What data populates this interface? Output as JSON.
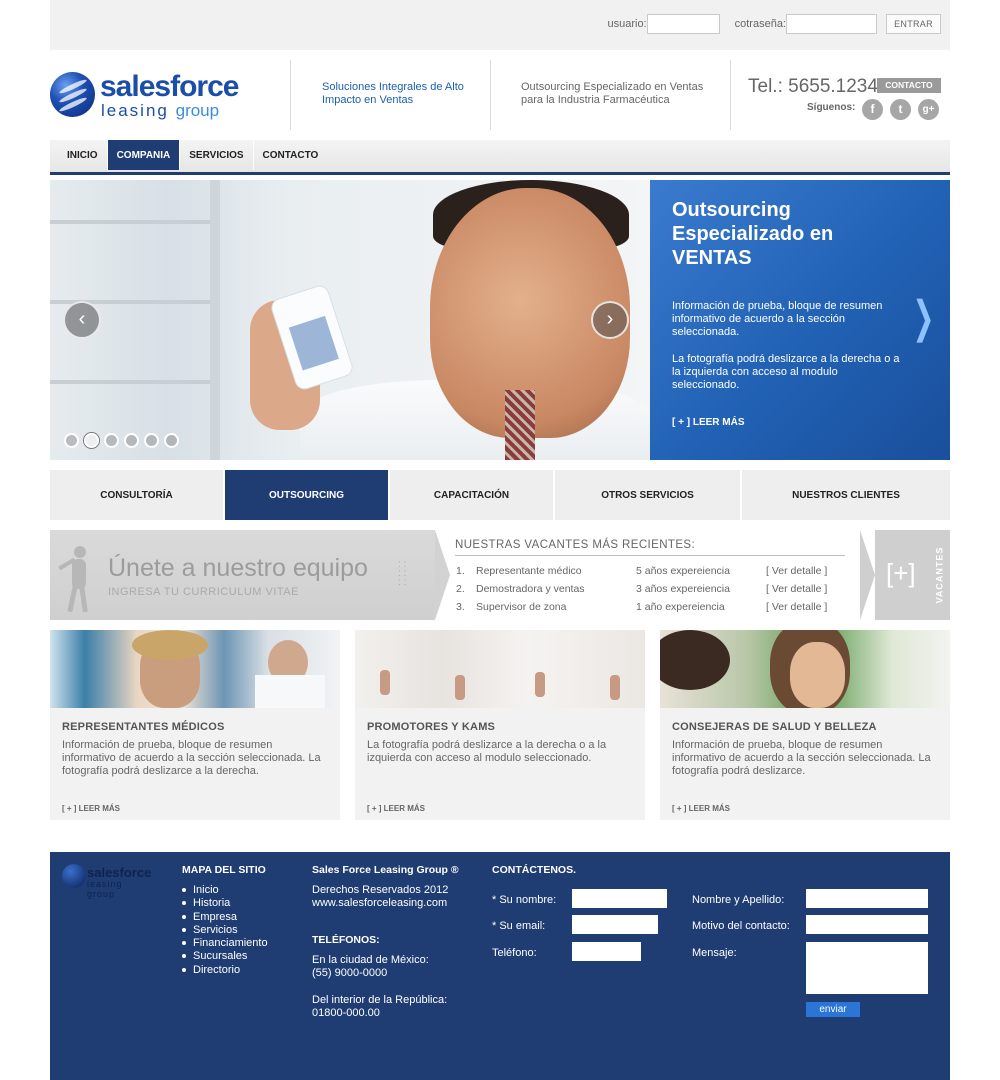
{
  "login": {
    "user_label": "usuario:",
    "pass_label": "cotraseña:",
    "submit_label": "ENTRAR"
  },
  "header": {
    "logo_word1": "salesforce",
    "logo_word2a": "leasing",
    "logo_word2b": "group",
    "tagline1": "Soluciones Integrales de Alto Impacto en Ventas",
    "tagline2": "Outsourcing Especializado en Ventas para la Industria Farmacéutica",
    "phone": "Tel.: 5655.1234",
    "contact_label": "CONTACTO",
    "follow_label": "Síguenos:",
    "social": [
      {
        "icon": "facebook-icon",
        "glyph": "f"
      },
      {
        "icon": "twitter-icon",
        "glyph": "t"
      },
      {
        "icon": "google-plus-icon",
        "glyph": "g+"
      }
    ]
  },
  "nav": {
    "items": [
      {
        "label": "INICIO",
        "active": false
      },
      {
        "label": "COMPANIA",
        "active": true
      },
      {
        "label": "SERVICIOS",
        "active": false
      },
      {
        "label": "CONTACTO",
        "active": false
      }
    ]
  },
  "hero": {
    "title": "Outsourcing Especializado en VENTAS",
    "para1": "Información de prueba, bloque de resumen informativo de acuerdo a la sección seleccionada.",
    "para2": "La fotografía podrá deslizarce a la derecha o a la izquierda con acceso al modulo seleccionado.",
    "more": "[ + ] LEER MÁS",
    "slide_count": 6,
    "active_slide": 2
  },
  "tabs": [
    {
      "label": "CONSULTORÍA",
      "active": false
    },
    {
      "label": "OUTSOURCING",
      "active": true
    },
    {
      "label": "CAPACITACIÓN",
      "active": false
    },
    {
      "label": "OTROS SERVICIOS",
      "active": false
    },
    {
      "label": "NUESTROS CLIENTES",
      "active": false
    }
  ],
  "vacancies": {
    "join_title": "Únete a nuestro equipo",
    "join_sub": "INGRESA TU CURRICULUM VITAE",
    "list_title": "NUESTRAS VACANTES MÁS RECIENTES:",
    "rows": [
      {
        "num": "1.",
        "position": "Representante médico",
        "experience": "5 años expereiencia",
        "link": "[ Ver detalle ]"
      },
      {
        "num": "2.",
        "position": "Demostradora y ventas",
        "experience": "3 años expereiencia",
        "link": "[ Ver detalle ]"
      },
      {
        "num": "3.",
        "position": "Supervisor de zona",
        "experience": "1 año expereiencia",
        "link": "[ Ver detalle ]"
      }
    ],
    "more_symbol": "[+]",
    "more_label": "VACANTES"
  },
  "cards": [
    {
      "title": "REPRESENTANTES MÉDICOS",
      "text": "Información de prueba, bloque de resumen informativo de acuerdo a la sección seleccionada. La fotografía podrá deslizarce a la derecha.",
      "more": "[ + ] LEER MÁS"
    },
    {
      "title": "PROMOTORES Y KAMS",
      "text": "La fotografía podrá deslizarce a la derecha o a la izquierda con acceso al modulo seleccionado.",
      "more": "[ + ] LEER MÁS"
    },
    {
      "title": "CONSEJERAS DE SALUD Y BELLEZA",
      "text": "Información de prueba, bloque de resumen informativo de acuerdo a la sección seleccionada. La fotografía podrá deslizarce.",
      "more": "[ + ] LEER MÁS"
    }
  ],
  "footer": {
    "logo_word1": "salesforce",
    "logo_word2": "leasing group",
    "sitemap_title": "MAPA DEL SITIO",
    "sitemap": [
      "Inicio",
      "Historia",
      "Empresa",
      "Servicios",
      "Financiamiento",
      "Sucursales",
      "Directorio"
    ],
    "company": "Sales Force Leasing Group ®",
    "rights": "Derechos Reservados 2012",
    "website": "www.salesforceleasing.com",
    "phones_title": "TELÉFONOS:",
    "city_label": "En la ciudad de México:",
    "city_phone": "(55) 9000-0000",
    "interior_label": "Del interior de la República:",
    "interior_phone": "01800-000.00",
    "contact_title": "CONTÁCTENOS.",
    "name_label": "* Su nombre:",
    "email_label": "* Su email:",
    "phone_label": "Teléfono:",
    "fullname_label": "Nombre y Apellido:",
    "reason_label": "Motivo del contacto:",
    "message_label": "Mensaje:",
    "send_label": "enviar"
  },
  "colors": {
    "brand_blue": "#1f3d72",
    "accent_blue": "#2161b4",
    "link_blue": "#1a5fb0"
  }
}
